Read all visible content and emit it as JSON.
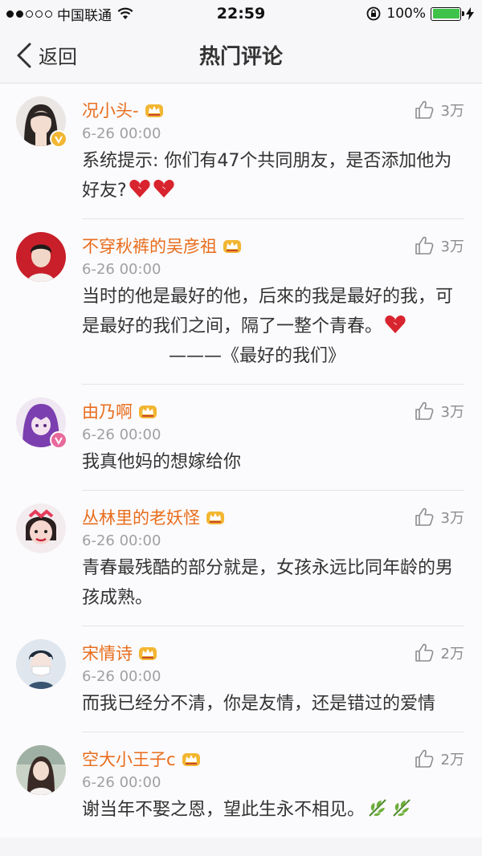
{
  "status_bar": {
    "carrier": "中国联通",
    "time": "22:59",
    "battery_percent": "100%",
    "battery_level": 1.0
  },
  "nav": {
    "back_label": "返回",
    "title": "热门评论"
  },
  "comments": [
    {
      "name": "况小头-",
      "date": "6-26 00:00",
      "likes": "3万",
      "text": "系统提示: 你们有47个共同朋友，是否添加他为好友?",
      "badge": "yellow-v",
      "emoji": [
        "broken-heart",
        "broken-heart"
      ]
    },
    {
      "name": "不穿秋裤的吴彦祖",
      "date": "6-26 00:00",
      "likes": "3万",
      "text": "当时的他是最好的他，后來的我是最好的我，可是最好的我们之间，隔了一整个青春。",
      "quote": "———《最好的我们》",
      "emoji": [
        "broken-heart"
      ]
    },
    {
      "name": "由乃啊",
      "date": "6-26 00:00",
      "likes": "3万",
      "text": "我真他妈的想嫁给你",
      "badge": "pink-v"
    },
    {
      "name": "丛林里的老妖怪",
      "date": "6-26 00:00",
      "likes": "3万",
      "text": "青春最残酷的部分就是，女孩永远比同年龄的男孩成熟。"
    },
    {
      "name": "宋情诗",
      "date": "6-26 00:00",
      "likes": "2万",
      "text": "而我已经分不清，你是友情，还是错过的爱情"
    },
    {
      "name": "空大小王子c",
      "date": "6-26 00:00",
      "likes": "2万",
      "text": "谢当年不娶之恩，望此生永不相见。",
      "emoji": [
        "leaf",
        "leaf"
      ]
    }
  ],
  "colors": {
    "name": "#e86d1c",
    "date": "#a09fa3",
    "accent_vip": "#f2b632"
  }
}
